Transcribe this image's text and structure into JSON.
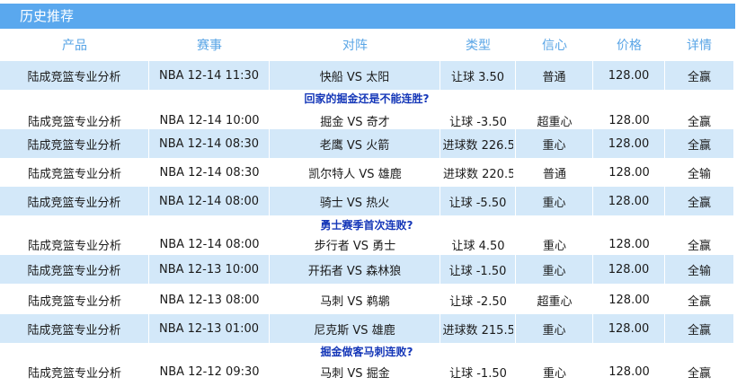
{
  "panel": {
    "title": "历史推荐"
  },
  "headers": [
    "产品",
    "赛事",
    "对阵",
    "类型",
    "信心",
    "价格",
    "详情"
  ],
  "rows": [
    {
      "product": "陆成竞篮专业分析",
      "event": "NBA 12-14 11:30",
      "match": "快船 VS 太阳",
      "type": "让球 3.50",
      "confidence": "普通",
      "price": "128.00",
      "detail": "全赢",
      "note": "回家的掘金还是不能连胜?"
    },
    {
      "product": "陆成竞篮专业分析",
      "event": "NBA 12-14 10:00",
      "match": "掘金 VS 奇才",
      "type": "让球 -3.50",
      "confidence": "超重心",
      "price": "128.00",
      "detail": "全赢",
      "note": ""
    },
    {
      "product": "陆成竞篮专业分析",
      "event": "NBA 12-14 08:30",
      "match": "老鹰 VS 火箭",
      "type": "进球数 226.50",
      "confidence": "重心",
      "price": "128.00",
      "detail": "全赢",
      "note": ""
    },
    {
      "product": "陆成竞篮专业分析",
      "event": "NBA 12-14 08:30",
      "match": "凯尔特人 VS 雄鹿",
      "type": "进球数 220.50",
      "confidence": "普通",
      "price": "128.00",
      "detail": "全输",
      "note": ""
    },
    {
      "product": "陆成竞篮专业分析",
      "event": "NBA 12-14 08:00",
      "match": "骑士 VS 热火",
      "type": "让球 -5.50",
      "confidence": "重心",
      "price": "128.00",
      "detail": "全赢",
      "note": "勇士赛季首次连败?"
    },
    {
      "product": "陆成竞篮专业分析",
      "event": "NBA 12-14 08:00",
      "match": "步行者 VS 勇士",
      "type": "让球 4.50",
      "confidence": "重心",
      "price": "128.00",
      "detail": "全赢",
      "note": ""
    },
    {
      "product": "陆成竞篮专业分析",
      "event": "NBA 12-13 10:00",
      "match": "开拓者 VS 森林狼",
      "type": "让球 -1.50",
      "confidence": "重心",
      "price": "128.00",
      "detail": "全输",
      "note": ""
    },
    {
      "product": "陆成竞篮专业分析",
      "event": "NBA 12-13 08:00",
      "match": "马刺 VS 鹈鹕",
      "type": "让球 -2.50",
      "confidence": "超重心",
      "price": "128.00",
      "detail": "全赢",
      "note": ""
    },
    {
      "product": "陆成竞篮专业分析",
      "event": "NBA 12-13 01:00",
      "match": "尼克斯 VS 雄鹿",
      "type": "进球数 215.50",
      "confidence": "重心",
      "price": "128.00",
      "detail": "全赢",
      "note": "掘金做客马刺连败?"
    },
    {
      "product": "陆成竞篮专业分析",
      "event": "NBA 12-12 09:30",
      "match": "马刺 VS 掘金",
      "type": "让球 -1.50",
      "confidence": "重心",
      "price": "128.00",
      "detail": "全赢",
      "note": ""
    }
  ]
}
